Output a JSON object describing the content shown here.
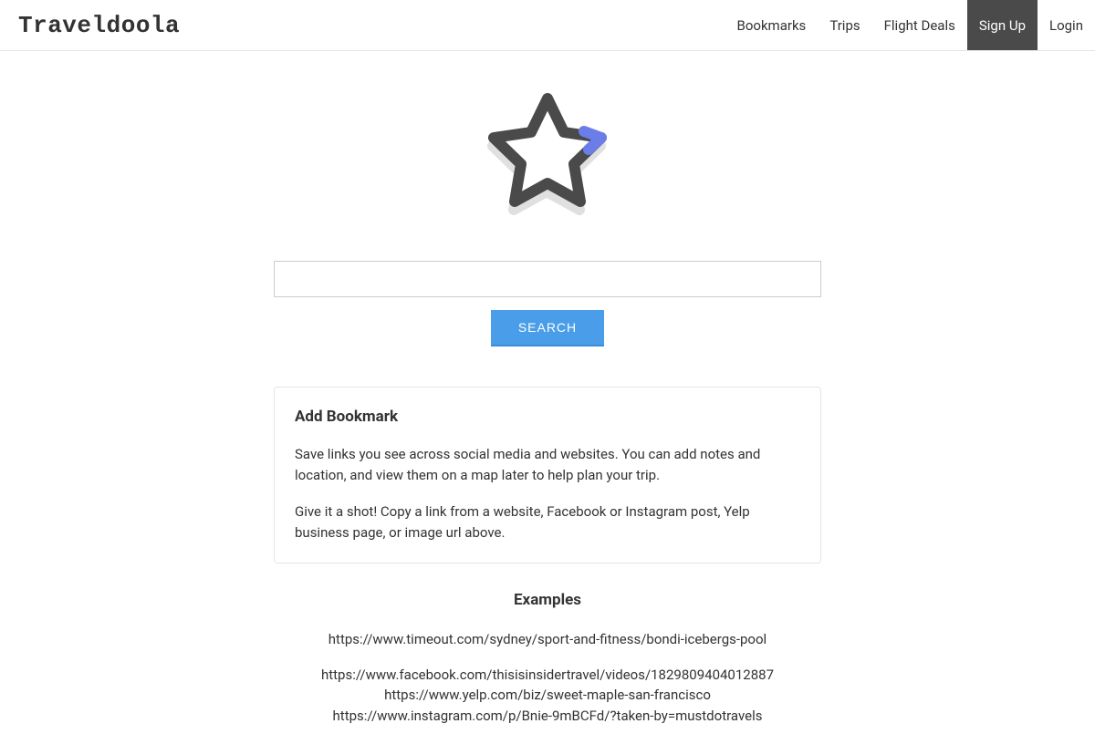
{
  "header": {
    "logo": "Traveldoola",
    "nav": [
      {
        "label": "Bookmarks",
        "highlighted": false
      },
      {
        "label": "Trips",
        "highlighted": false
      },
      {
        "label": "Flight Deals",
        "highlighted": false
      },
      {
        "label": "Sign Up",
        "highlighted": true
      },
      {
        "label": "Login",
        "highlighted": false
      }
    ]
  },
  "search": {
    "value": "",
    "button_label": "SEARCH"
  },
  "card": {
    "title": "Add Bookmark",
    "paragraph1": "Save links you see across social media and websites. You can add notes and location, and view them on a map later to help plan your trip.",
    "paragraph2": "Give it a shot! Copy a link from a website, Facebook or Instagram post, Yelp business page, or image url above."
  },
  "examples": {
    "title": "Examples",
    "links": [
      "https://www.timeout.com/sydney/sport-and-fitness/bondi-icebergs-pool",
      "https://www.facebook.com/thisisinsidertravel/videos/1829809404012887",
      "https://www.yelp.com/biz/sweet-maple-san-francisco",
      "https://www.instagram.com/p/Bnie-9mBCFd/?taken-by=mustdotravels"
    ]
  }
}
